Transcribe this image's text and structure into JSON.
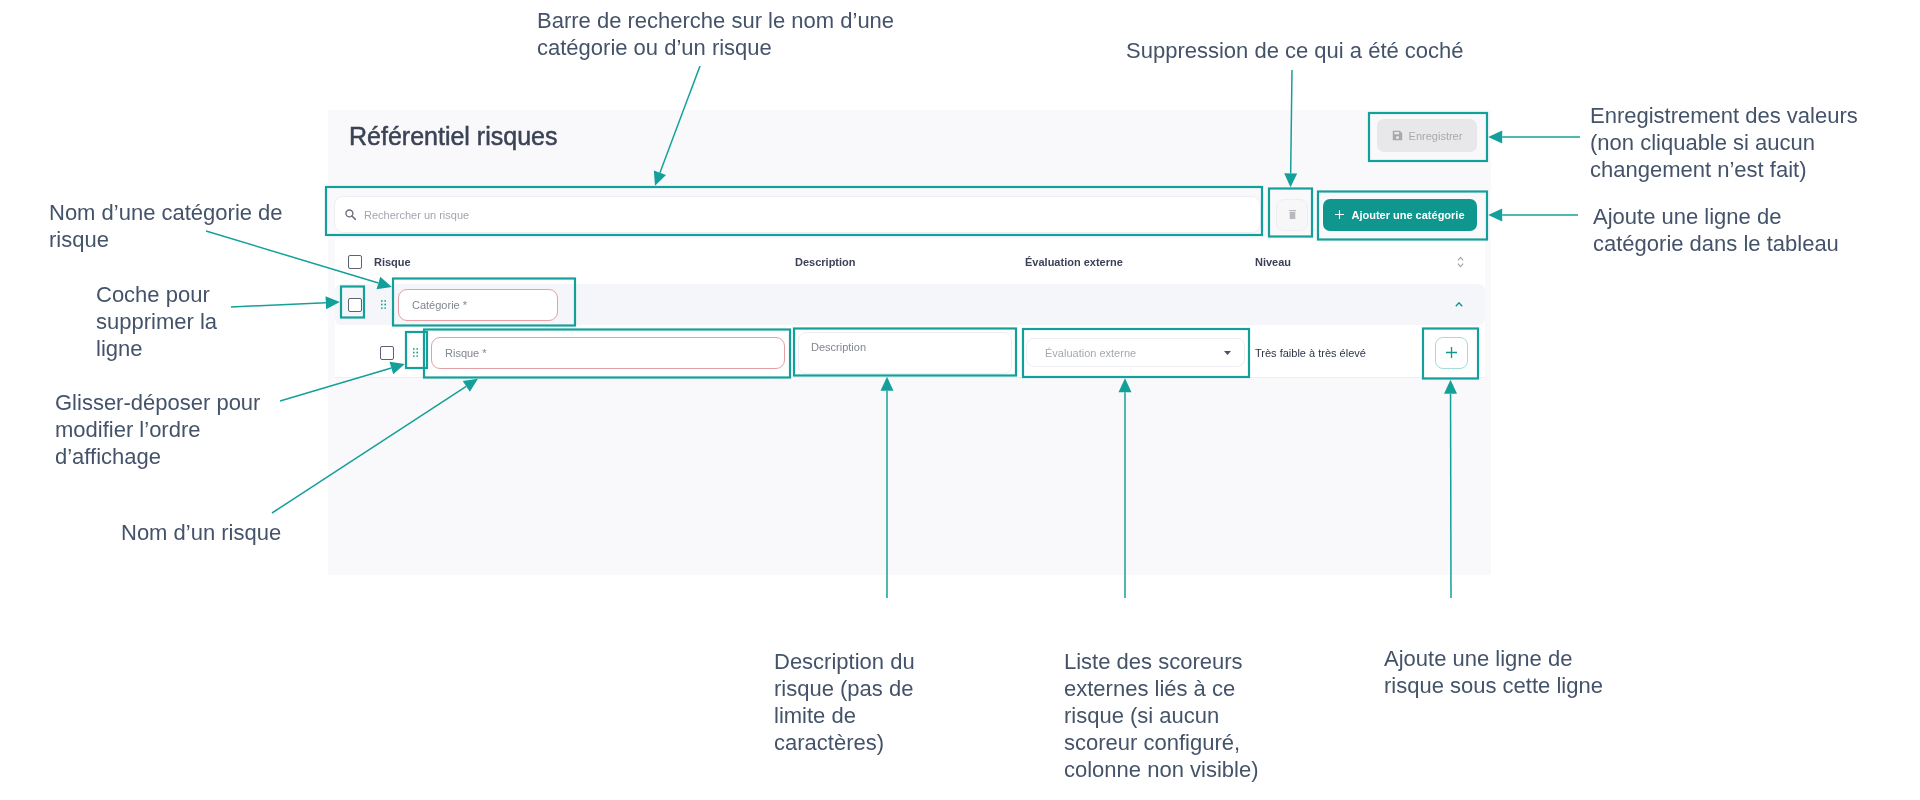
{
  "page": {
    "title": "Référentiel risques"
  },
  "save_button": {
    "label": "Enregistrer",
    "disabled": true
  },
  "toolbar": {
    "search": {
      "placeholder": "Rechercher un risque"
    },
    "delete_button": {
      "disabled": true
    },
    "add_button": {
      "label": "Ajouter une catégorie"
    }
  },
  "table": {
    "select_all": {
      "checked": false
    },
    "columns": [
      "Risque",
      "Description",
      "Évaluation externe",
      "Niveau"
    ],
    "rows": [
      {
        "kind": "category",
        "checked": false,
        "expanded": true,
        "name": {
          "placeholder": "Catégorie *",
          "invalid": true
        },
        "children": [
          {
            "kind": "risk",
            "checked": false,
            "name": {
              "placeholder": "Risque *",
              "invalid": true
            },
            "description": {
              "placeholder": "Description"
            },
            "evaluation": {
              "placeholder": "Évaluation externe"
            },
            "level_range": "Très faible à très élevé"
          }
        ]
      }
    ]
  },
  "annotations": [
    "Barre de recherche sur le nom d’une catégorie ou d’un risque",
    "Suppression de ce qui a été coché",
    "Enregistrement des valeurs (non cliquable si aucun changement n’est fait)",
    "Nom d’une catégorie de risque",
    "Ajoute une ligne de catégorie dans le tableau",
    "Coche pour supprimer la ligne",
    "Glisser-déposer pour modifier l’ordre d’affichage",
    "Nom d’un risque",
    "Description du risque (pas de limite de caractères)",
    "Liste des scoreurs externes liés à ce risque (si aucun scoreur configuré, colonne non visible)",
    "Ajoute une ligne de risque sous cette ligne"
  ]
}
